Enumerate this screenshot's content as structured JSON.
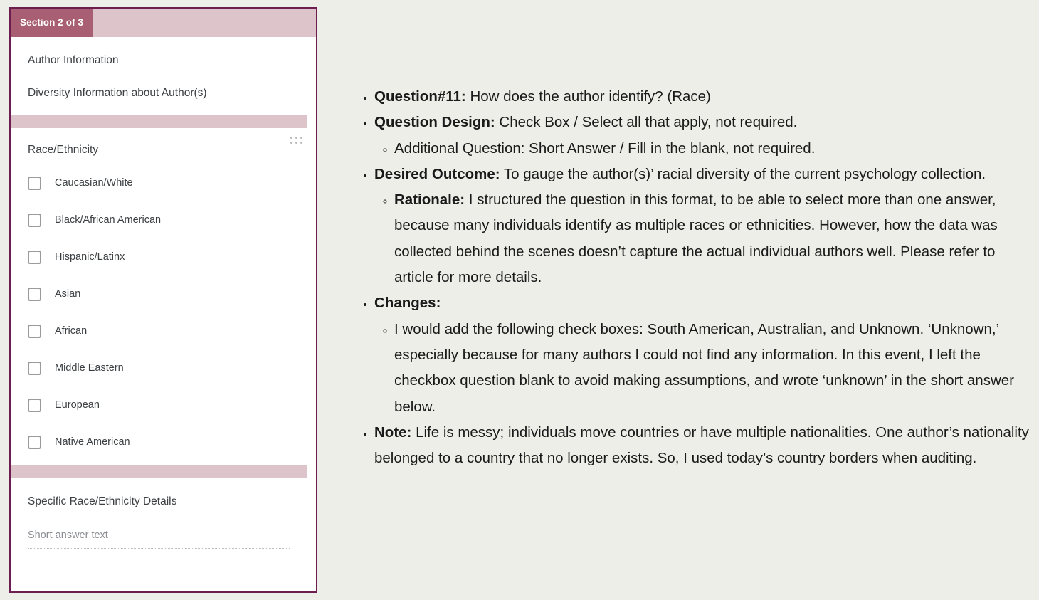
{
  "form": {
    "section_tab": "Section 2 of 3",
    "header": {
      "title": "Author Information",
      "subtitle": "Diversity Information about Author(s)"
    },
    "question": {
      "label": "Race/Ethnicity",
      "drag_handle_icon": "drag-handle-icon",
      "options": [
        "Caucasian/White",
        "Black/African American",
        "Hispanic/Latinx",
        "Asian",
        "African",
        "Middle Eastern",
        "European",
        "Native American"
      ]
    },
    "short_answer": {
      "label": "Specific Race/Ethnicity Details",
      "placeholder": "Short answer text"
    },
    "colors": {
      "card_border": "#6e1d50",
      "tab_active": "#a85f73",
      "band": "#ddc3ca",
      "text": "#3c4043",
      "placeholder": "#8a8d91"
    }
  },
  "notes": {
    "question_label": "Question#11:",
    "question_text": " How does the author identify? (Race)",
    "design_label": "Question Design:",
    "design_text": " Check Box / Select all that apply, not required.",
    "design_sub": "Additional Question: Short Answer / Fill in the blank, not required.",
    "outcome_label": "Desired Outcome:",
    "outcome_text": " To gauge the author(s)’ racial diversity of the current psychology collection.",
    "rationale_label": "Rationale:",
    "rationale_text": " I structured the question in this format, to be able to select more than one answer, because many individuals identify as multiple races or ethnicities. However, how the data was collected behind the scenes doesn’t capture the actual individual authors well. Please refer to article for more details.",
    "changes_label": "Changes:",
    "changes_sub": "I would add the following check boxes: South American, Australian, and Unknown. ‘Unknown,’ especially because for many authors I could not find any information. In this event, I left the checkbox question blank to avoid making assumptions, and wrote ‘unknown’ in the short answer below.",
    "note_label": "Note:",
    "note_text": " Life is messy; individuals move countries or have multiple nationalities. One author’s nationality belonged to a country that no longer exists. So, I used today’s country borders when auditing."
  }
}
